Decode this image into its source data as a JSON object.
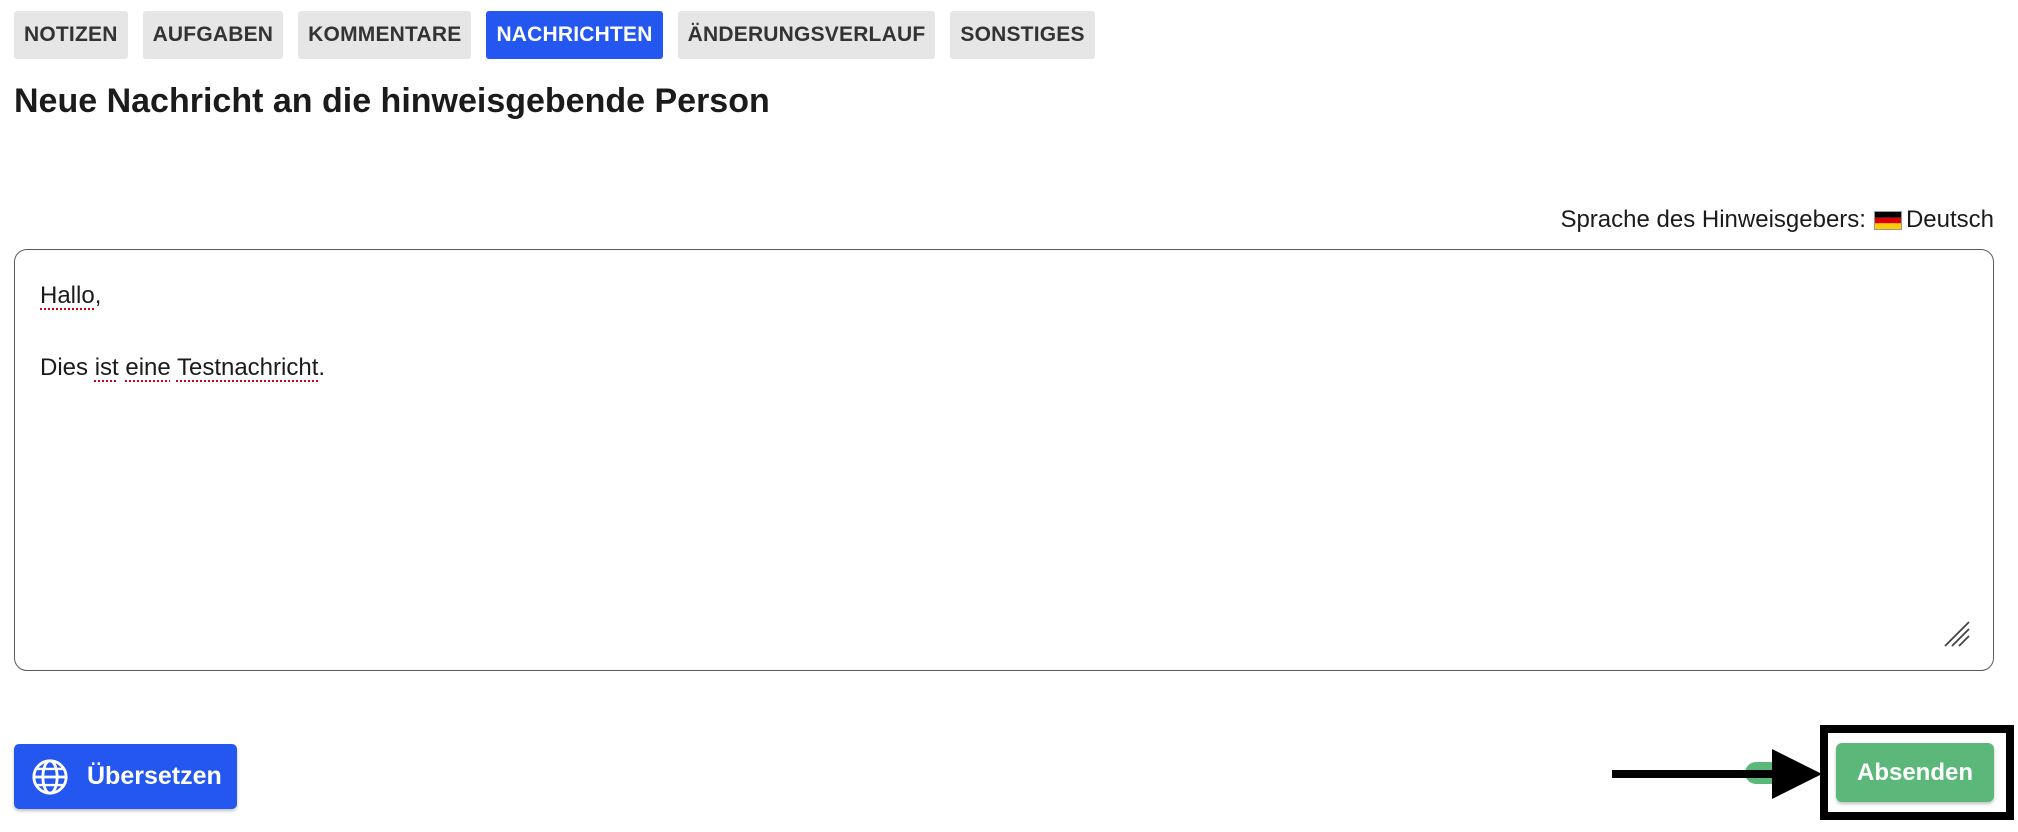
{
  "tabs": [
    {
      "label": "NOTIZEN",
      "active": false
    },
    {
      "label": "AUFGABEN",
      "active": false
    },
    {
      "label": "KOMMENTARE",
      "active": false
    },
    {
      "label": "NACHRICHTEN",
      "active": true
    },
    {
      "label": "ÄNDERUNGSVERLAUF",
      "active": false
    },
    {
      "label": "SONSTIGES",
      "active": false
    }
  ],
  "heading": "Neue Nachricht an die hinweisgebende Person",
  "language": {
    "label": "Sprache des Hinweisgebers:",
    "value": "Deutsch",
    "flag_icon": "german-flag-icon"
  },
  "message": {
    "line1_word": "Hallo",
    "line1_punct": ",",
    "line2_w1": "Dies",
    "line2_w2": "ist",
    "line2_w3": "eine",
    "line2_w4": "Testnachricht",
    "line2_end": "."
  },
  "actions": {
    "translate_label": "Übersetzen",
    "translate_icon": "globe-icon",
    "send_label": "Absenden"
  },
  "colors": {
    "accent_blue": "#2456f0",
    "send_green": "#5cb87a",
    "tab_inactive": "#e6e6e6",
    "spellcheck_red": "#d0021b"
  }
}
